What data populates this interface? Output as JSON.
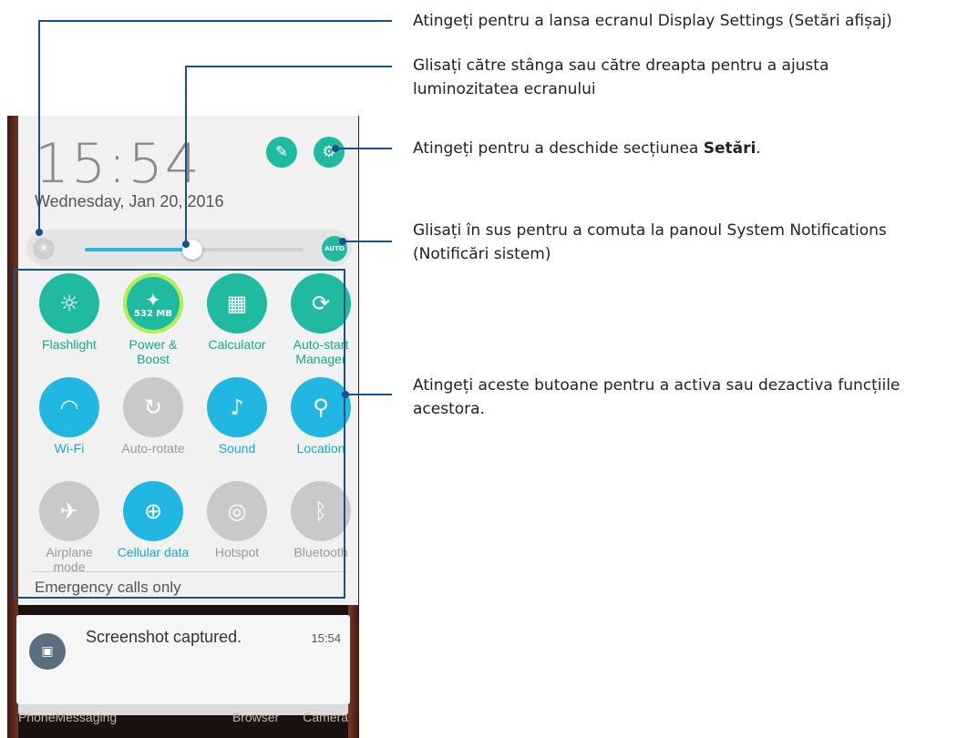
{
  "phone": {
    "clock": "15:54",
    "date": "Wednesday, Jan 20, 2016",
    "edit_icon": "edit-notes-icon",
    "settings_icon": "gear-icon",
    "brightness": {
      "level": 0.49,
      "auto_label": "AUTO"
    },
    "tiles": [
      {
        "label": "Flashlight",
        "icon": "flashlight-icon",
        "state": "on"
      },
      {
        "label": "Power &\nBoost",
        "icon": "broom-icon",
        "state": "boost",
        "badge": "532 MB"
      },
      {
        "label": "Calculator",
        "icon": "calculator-icon",
        "state": "on"
      },
      {
        "label": "Auto-start\nManager",
        "icon": "auto-start-icon",
        "state": "on"
      },
      {
        "label": "Wi-Fi",
        "icon": "wifi-icon",
        "state": "blue"
      },
      {
        "label": "Auto-rotate",
        "icon": "rotate-icon",
        "state": "off"
      },
      {
        "label": "Sound",
        "icon": "speaker-icon",
        "state": "blue"
      },
      {
        "label": "Location",
        "icon": "location-pin-icon",
        "state": "blue"
      },
      {
        "label": "Airplane\nmode",
        "icon": "airplane-icon",
        "state": "off"
      },
      {
        "label": "Cellular data",
        "icon": "globe-icon",
        "state": "blue"
      },
      {
        "label": "Hotspot",
        "icon": "hotspot-icon",
        "state": "off"
      },
      {
        "label": "Bluetooth",
        "icon": "bluetooth-icon",
        "state": "off"
      }
    ],
    "emergency": "Emergency calls only",
    "notification": {
      "text": "Screenshot captured.",
      "time": "15:54",
      "icon": "image-icon"
    },
    "dock": [
      "Phone",
      "Messaging",
      "Browser",
      "Camera"
    ]
  },
  "annotations": {
    "display_settings": "Atingeți pentru a lansa ecranul Display Settings (Setări afișaj)",
    "brightness_1": "Glisați către stânga sau către dreapta pentru a ajusta",
    "brightness_2": "luminozitatea ecranului",
    "settings_prefix": "Atingeți pentru a deschide secțiunea ",
    "settings_bold": "Setări",
    "settings_suffix": ".",
    "notif_1": "Glisați în sus pentru a comuta la panoul System Notifications",
    "notif_2": "(Notificări sistem)",
    "buttons_1": "Atingeți aceste butoane pentru a activa sau dezactiva funcțiile",
    "buttons_2": "acestora.",
    "line_color": "#17508a"
  }
}
